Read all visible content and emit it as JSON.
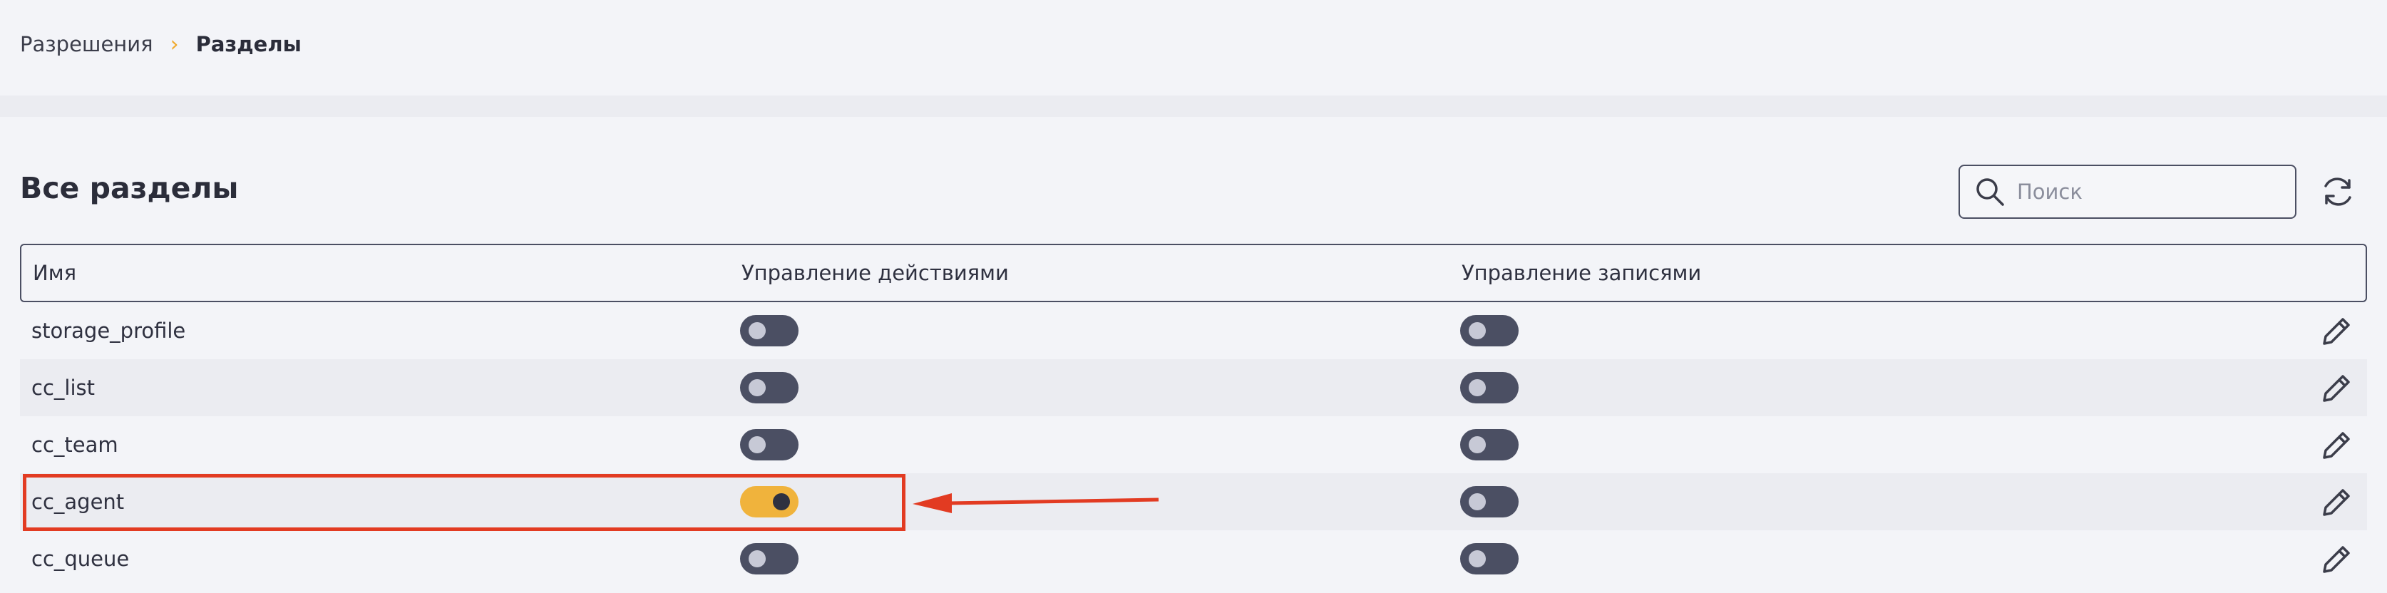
{
  "breadcrumb": {
    "parent": "Разрешения",
    "separator": "›",
    "current": "Разделы"
  },
  "section": {
    "title": "Все разделы"
  },
  "search": {
    "placeholder": "Поиск",
    "value": ""
  },
  "table": {
    "columns": [
      "Имя",
      "Управление действиями",
      "Управление записями"
    ],
    "rows": [
      {
        "name": "storage_profile",
        "action_control": false,
        "record_control": false
      },
      {
        "name": "cc_list",
        "action_control": false,
        "record_control": false
      },
      {
        "name": "cc_team",
        "action_control": false,
        "record_control": false
      },
      {
        "name": "cc_agent",
        "action_control": true,
        "record_control": false
      },
      {
        "name": "cc_queue",
        "action_control": false,
        "record_control": false
      }
    ]
  },
  "colors": {
    "accent": "#f0b33c",
    "toggle_off": "#4b4f63",
    "annotation": "#e23b22"
  },
  "icons": [
    "search-icon",
    "refresh-icon",
    "pencil-icon"
  ]
}
